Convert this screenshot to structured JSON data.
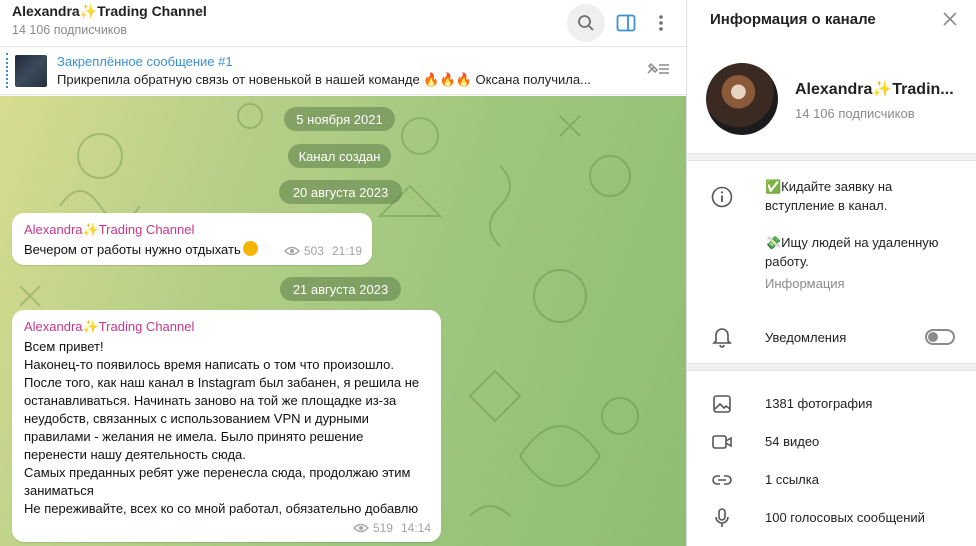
{
  "chat": {
    "title": "Alexandra✨Trading Channel",
    "subscribers": "14 106 подписчиков",
    "pinned": {
      "title": "Закреплённое сообщение #1",
      "text": "Прикрепила обратную связь от новенькой в нашей команде 🔥🔥🔥 Оксана получила..."
    },
    "date_pills": [
      "5 ноября 2021",
      "Канал создан",
      "20 августа 2023",
      "21 августа 2023"
    ],
    "messages": [
      {
        "author": "Alexandra✨Trading Channel",
        "text": "Вечером от работы нужно отдыхать",
        "views": "503",
        "time": "21:19"
      },
      {
        "author": "Alexandra✨Trading Channel",
        "text": "Всем привет!\nНаконец-то появилось время написать о том что произошло.\nПосле того, как наш канал в Instagram был забанен, я решила не останавливаться. Начинать заново на той же площадке из-за неудобств, связанных с использованием VPN и дурными правилами - желания не имела.  Было принято решение перенести нашу деятельность сюда.\nСамых преданных ребят уже перенесла сюда, продолжаю этим заниматься\nНе переживайте, всех ко со мной работал, обязательно добавлю",
        "views": "519",
        "time": "14:14"
      }
    ]
  },
  "info": {
    "header": "Информация о канале",
    "name": "Alexandra✨Tradin...",
    "subscribers": "14 106 подписчиков",
    "description_1": "✅Кидайте заявку на вступление в канал.",
    "description_2": "💸Ищу людей на удаленную работу.",
    "description_label": "Информация",
    "notifications_label": "Уведомления",
    "notifications_on": false,
    "media": {
      "photos": "1381 фотография",
      "videos": "54 видео",
      "links": "1 ссылка",
      "voice": "100 голосовых сообщений"
    }
  },
  "colors": {
    "accent": "#3a8fd6",
    "author": "#c2378b",
    "pill_bg": "#5c8048"
  },
  "icons": [
    "search-icon",
    "sidebar-toggle-icon",
    "more-icon",
    "pin-list-icon",
    "close-icon",
    "info-icon",
    "bell-icon",
    "photo-icon",
    "video-icon",
    "link-icon",
    "mic-icon",
    "eye-icon"
  ]
}
